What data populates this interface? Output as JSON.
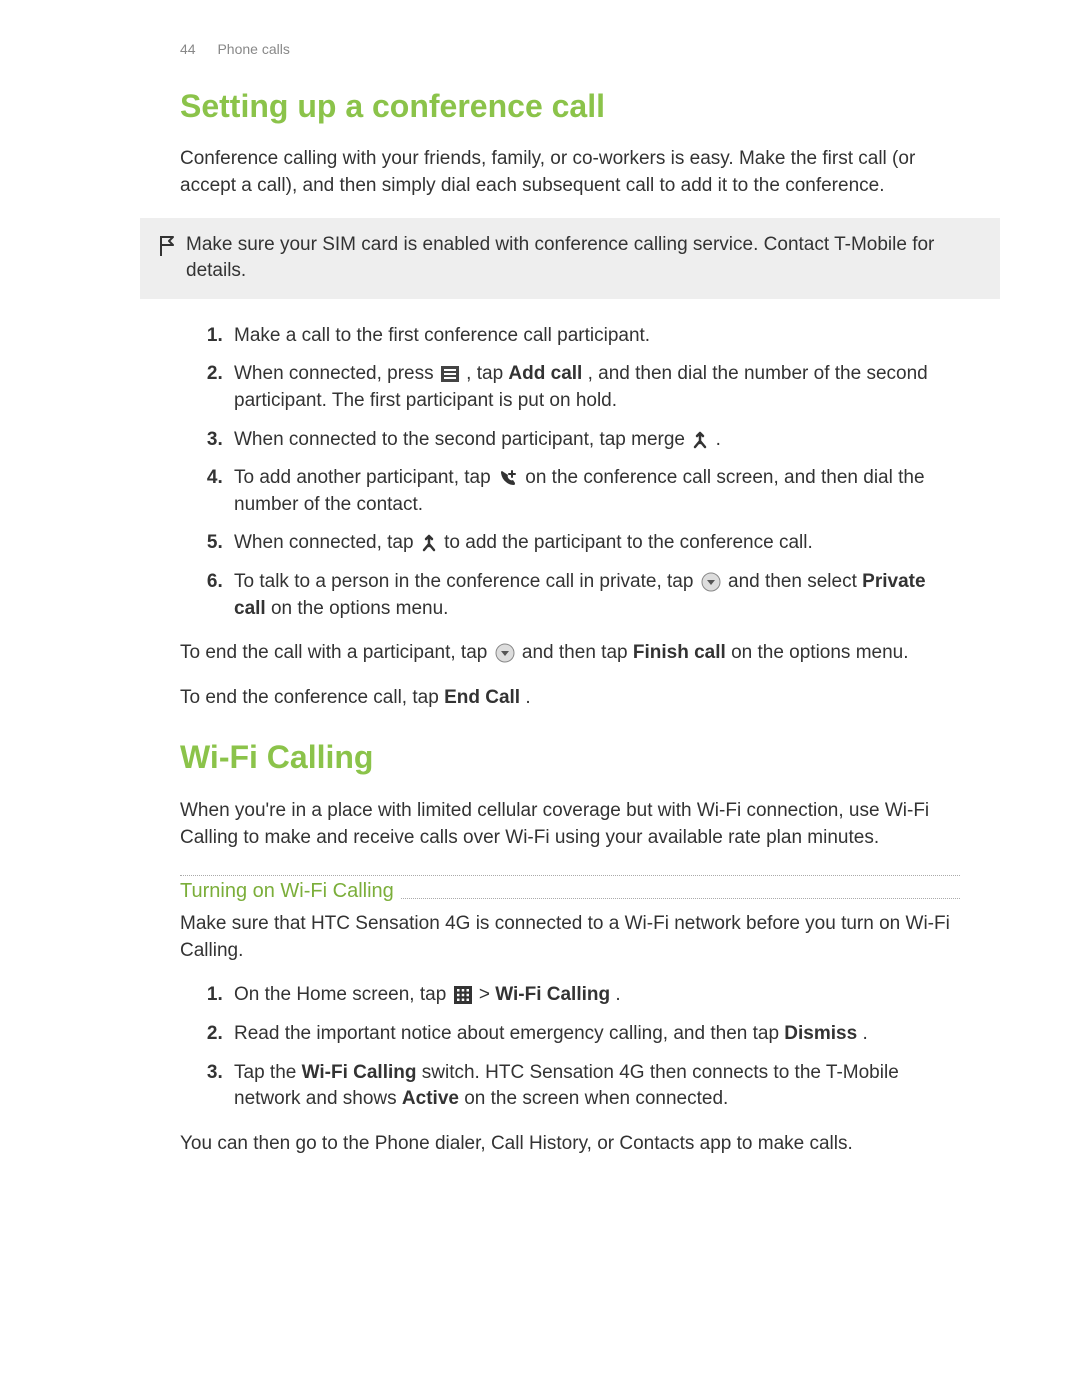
{
  "header": {
    "page_number": "44",
    "section": "Phone calls"
  },
  "h1a": "Setting up a conference call",
  "intro_a": "Conference calling with your friends, family, or co-workers is easy. Make the first call (or accept a call), and then simply dial each subsequent call to add it to the conference.",
  "note_a": "Make sure your SIM card is enabled with conference calling service. Contact T-Mobile for details.",
  "steps_a": {
    "s1": "Make a call to the first conference call participant.",
    "s2a": "When connected, press ",
    "s2b": " , tap ",
    "s2_bold": "Add call",
    "s2c": ", and then dial the number of the second participant. The first participant is put on hold.",
    "s3a": "When connected to the second participant, tap merge ",
    "s3b": " .",
    "s4a": "To add another participant, tap ",
    "s4b": " on the conference call screen, and then dial the number of the contact.",
    "s5a": "When connected, tap ",
    "s5b": " to add the participant to the conference call.",
    "s6a": "To talk to a person in the conference call in private, tap ",
    "s6b": " and then select ",
    "s6_bold": "Private call",
    "s6c": " on the options menu."
  },
  "after_a1a": "To end the call with a participant, tap ",
  "after_a1b": " and then tap ",
  "after_a1_bold": "Finish call",
  "after_a1c": " on the options menu.",
  "after_a2a": "To end the conference call, tap ",
  "after_a2_bold": "End Call",
  "after_a2b": ".",
  "h1b": "Wi-Fi Calling",
  "intro_b": "When you're in a place with limited cellular coverage but with Wi-Fi connection, use Wi-Fi Calling to make and receive calls over Wi-Fi using your available rate plan minutes.",
  "sub_b": "Turning on Wi-Fi Calling",
  "para_b": "Make sure that HTC Sensation 4G is connected to a Wi-Fi network before you turn on Wi-Fi Calling.",
  "steps_b": {
    "s1a": "On the Home screen, tap ",
    "s1b": "  > ",
    "s1_bold": "Wi-Fi Calling",
    "s1c": ".",
    "s2a": "Read the important notice about emergency calling, and then tap ",
    "s2_bold": "Dismiss",
    "s2b": ".",
    "s3a": "Tap the ",
    "s3_bold1": "Wi-Fi Calling",
    "s3b": " switch. HTC Sensation 4G then connects to the T-Mobile network and shows ",
    "s3_bold2": "Active",
    "s3c": " on the screen when connected."
  },
  "after_b": "You can then go to the Phone dialer, Call History, or Contacts app to make calls."
}
